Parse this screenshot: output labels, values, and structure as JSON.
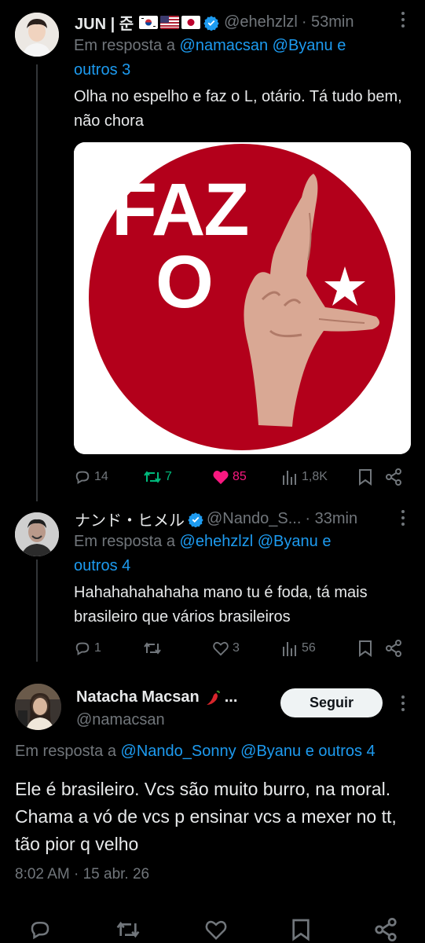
{
  "tweets": [
    {
      "display_name": "JUN | 준",
      "handle": "@ehehzlzl",
      "time": "· 53min",
      "reply_prefix": "Em resposta a",
      "mentions": "@namacsan @Byanu e",
      "mentions2": "outros 3",
      "text": "Olha no espelho e faz o L, otário. Tá tudo bem, não chora",
      "image_text": "FAZ O",
      "replies": "14",
      "retweets": "7",
      "likes": "85",
      "views": "1,8K"
    },
    {
      "display_name": "ナンド・ヒメル",
      "handle": "@Nando_S...",
      "time": "· 33min",
      "reply_prefix": "Em resposta a",
      "mentions": "@ehehzlzl @Byanu e",
      "mentions2": "outros 4",
      "text": "Hahahahahahaha mano tu é foda, tá mais brasileiro que vários brasileiros",
      "replies": "1",
      "retweets": "",
      "likes": "3",
      "views": "56"
    },
    {
      "display_name": "Natacha Macsan",
      "handle": "@namacsan",
      "follow_label": "Seguir",
      "reply_prefix": "Em resposta a",
      "mentions": "@Nando_Sonny @Byanu e outros 4",
      "text": "Ele é brasileiro. Vcs são muito burro, na moral. Chama a vó de vcs p ensinar vcs a mexer no tt, tão pior q velho",
      "timestamp": "8:02 AM",
      "date": "· 15 abr. 26"
    }
  ],
  "colors": {
    "accent": "#1d9bf0",
    "like": "#f91880",
    "retweet": "#00ba7c",
    "muted": "#71767b",
    "badge_red": "#b3001b"
  }
}
